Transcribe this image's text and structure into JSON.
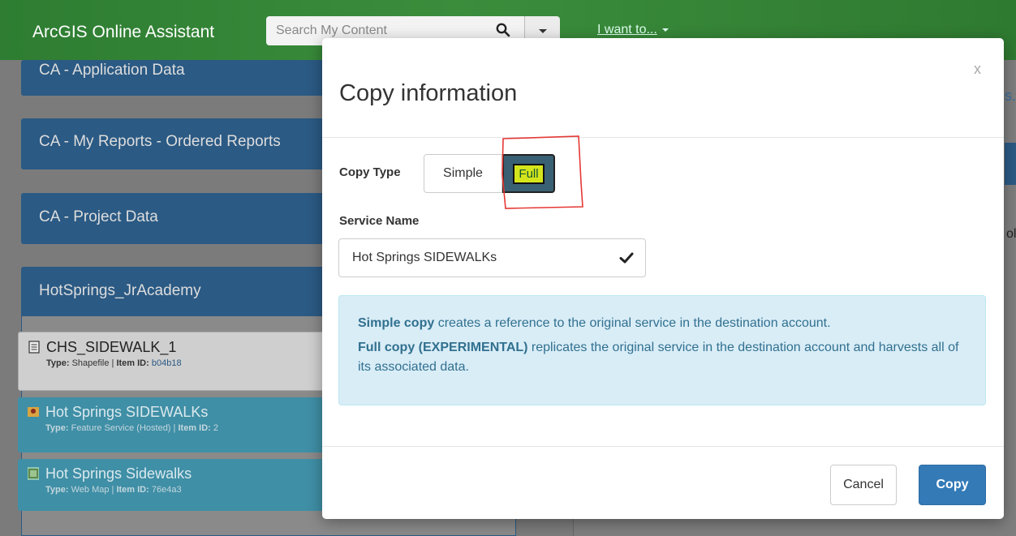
{
  "app": {
    "title": "ArcGIS Online Assistant"
  },
  "search": {
    "placeholder": "Search My Content"
  },
  "nav": {
    "i_want_to": "I want to..."
  },
  "groups": [
    {
      "label": "CA - Application Data"
    },
    {
      "label": "CA - My Reports - Ordered Reports"
    },
    {
      "label": "CA - Project Data"
    },
    {
      "label": "HotSprings_JrAcademy"
    }
  ],
  "items": [
    {
      "title": "CHS_SIDEWALK_1",
      "type_label": "Type:",
      "type": "Shapefile",
      "id_label": "Item ID:",
      "id": "b04b18",
      "icon": "document-icon"
    },
    {
      "title": "Hot Springs SIDEWALKs",
      "type_label": "Type:",
      "type": "Feature Service (Hosted)",
      "id_label": "Item ID:",
      "id": "2",
      "icon": "feature-service-icon"
    },
    {
      "title": "Hot Springs Sidewalks",
      "type_label": "Type:",
      "type": "Web Map",
      "id_label": "Item ID:",
      "id": "76e4a3",
      "icon": "web-map-icon"
    }
  ],
  "right_fragments": {
    "top": "s.",
    "mid": "ol"
  },
  "modal": {
    "title": "Copy information",
    "close": "x",
    "copy_type_label": "Copy Type",
    "options": {
      "simple": "Simple",
      "full": "Full"
    },
    "selected_option": "Full",
    "service_name_label": "Service Name",
    "service_name_value": "Hot Springs SIDEWALKs",
    "info": {
      "simple_title": "Simple copy",
      "simple_text": " creates a reference to the original service in the destination account.",
      "full_title": "Full copy (EXPERIMENTAL)",
      "full_text": " replicates the original service in the destination account and harvests all of its associated data."
    },
    "cancel_label": "Cancel",
    "copy_label": "Copy"
  },
  "colors": {
    "navbar": "#2e7d32",
    "panel": "#2b5a84",
    "info_bg": "#d9edf7",
    "primary": "#337ab7",
    "annotation": "#e53935",
    "highlight": "#d5e51c"
  }
}
